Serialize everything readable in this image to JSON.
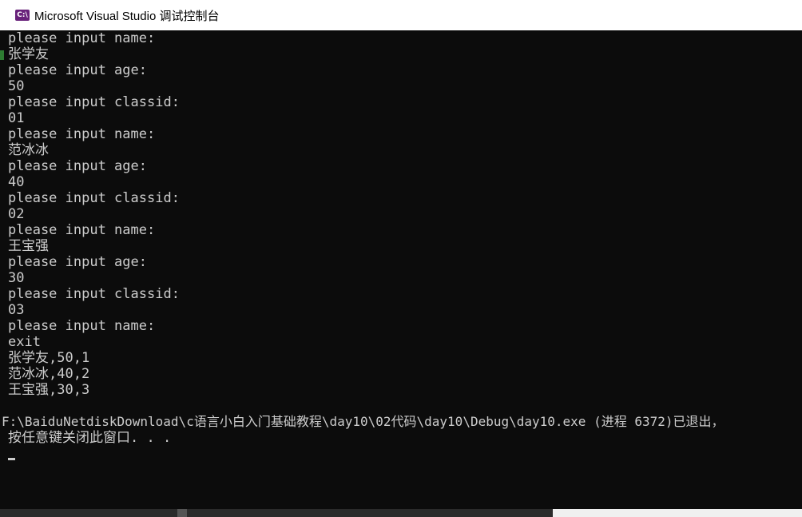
{
  "window": {
    "title": "Microsoft Visual Studio 调试控制台",
    "app_icon_text": "C:\\"
  },
  "console": {
    "lines": [
      "please input name:",
      "张学友",
      "please input age:",
      "50",
      "please input classid:",
      "01",
      "please input name:",
      "范冰冰",
      "please input age:",
      "40",
      "please input classid:",
      "02",
      "please input name:",
      "王宝强",
      "please input age:",
      "30",
      "please input classid:",
      "03",
      "please input name:",
      "exit",
      "张学友,50,1",
      "范冰冰,40,2",
      "王宝强,30,3",
      "",
      "F:\\BaiduNetdiskDownload\\c语言小白入门基础教程\\day10\\02代码\\day10\\Debug\\day10.exe (进程 6372)已退出，",
      "按任意键关闭此窗口. . ."
    ]
  },
  "colors": {
    "console_bg": "#0c0c0c",
    "console_text": "#cccccc",
    "titlebar_bg": "#ffffff",
    "vs_purple": "#68217a"
  }
}
